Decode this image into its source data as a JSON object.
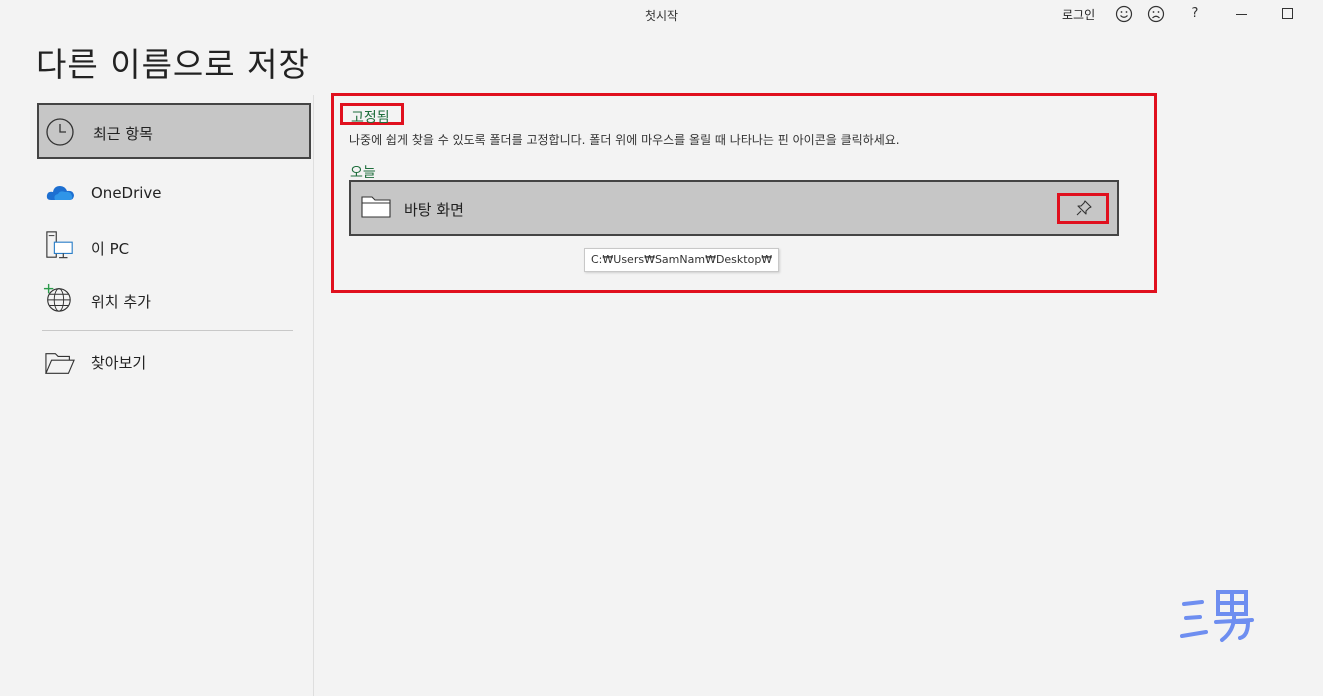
{
  "titlebar": {
    "app_title": "첫시작",
    "login_label": "로그인",
    "smile_icon": "smile-icon",
    "frown_icon": "frown-icon",
    "help_label": "?"
  },
  "page_title": "다른 이름으로 저장",
  "sidebar": {
    "items": [
      {
        "label": "최근 항목",
        "icon": "clock-icon",
        "active": true
      },
      {
        "label": "OneDrive",
        "icon": "onedrive-cloud-icon"
      },
      {
        "label": "이 PC",
        "icon": "this-pc-icon"
      },
      {
        "label": "위치 추가",
        "icon": "add-location-globe-icon"
      },
      {
        "label": "찾아보기",
        "icon": "open-folder-icon"
      }
    ]
  },
  "main": {
    "pinned_heading": "고정됨",
    "pinned_description": "나중에 쉽게 찾을 수 있도록 폴더를 고정합니다. 폴더 위에 마우스를 올릴 때 나타나는 핀 아이콘을 클릭하세요.",
    "today_heading": "오늘",
    "folders": [
      {
        "name": "바탕 화면",
        "path": "C:₩Users₩SamNam₩Desktop₩",
        "icon": "folder-icon"
      }
    ]
  },
  "watermark_text": "三男",
  "colors": {
    "highlight_red": "#e0101e",
    "heading_green": "#1e6e3c",
    "selection_gray": "#c6c6c6",
    "background": "#f3f3f3"
  }
}
